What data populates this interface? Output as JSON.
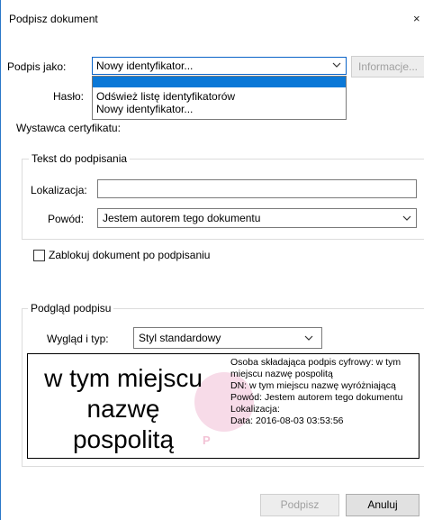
{
  "dialog": {
    "title": "Podpisz dokument",
    "close": "×"
  },
  "sign_as": {
    "label": "Podpis jako:",
    "value": "Nowy identyfikator...",
    "info_button": "Informacje...",
    "options": [
      "Odśwież listę identyfikatorów",
      "Nowy identyfikator..."
    ]
  },
  "password": {
    "label": "Hasło:"
  },
  "issuer": {
    "label": "Wystawca certyfikatu:"
  },
  "text_group": {
    "legend": "Tekst do podpisania",
    "location_label": "Lokalizacja:",
    "location_value": "",
    "reason_label": "Powód:",
    "reason_value": "Jestem autorem tego dokumentu"
  },
  "lock": {
    "label": "Zablokuj dokument po podpisaniu",
    "checked": false
  },
  "preview_group": {
    "legend": "Podgląd podpisu",
    "appearance_label": "Wygląd i typ:",
    "appearance_value": "Styl standardowy",
    "name_lines": [
      "w tym miejscu",
      "nazwę",
      "pospolitą"
    ],
    "details": [
      "Osoba składająca podpis cyfrowy: w tym miejscu nazwę pospolitą",
      "DN: w tym miejscu nazwę wyróżniającą",
      "Powód: Jestem autorem tego dokumentu",
      "Lokalizacja:",
      "Data: 2016-08-03 03:53:56"
    ],
    "watermark": "P"
  },
  "buttons": {
    "sign": "Podpisz",
    "cancel": "Anuluj"
  },
  "colors": {
    "accent": "#0a78d7",
    "window_border": "#2a78c8"
  }
}
